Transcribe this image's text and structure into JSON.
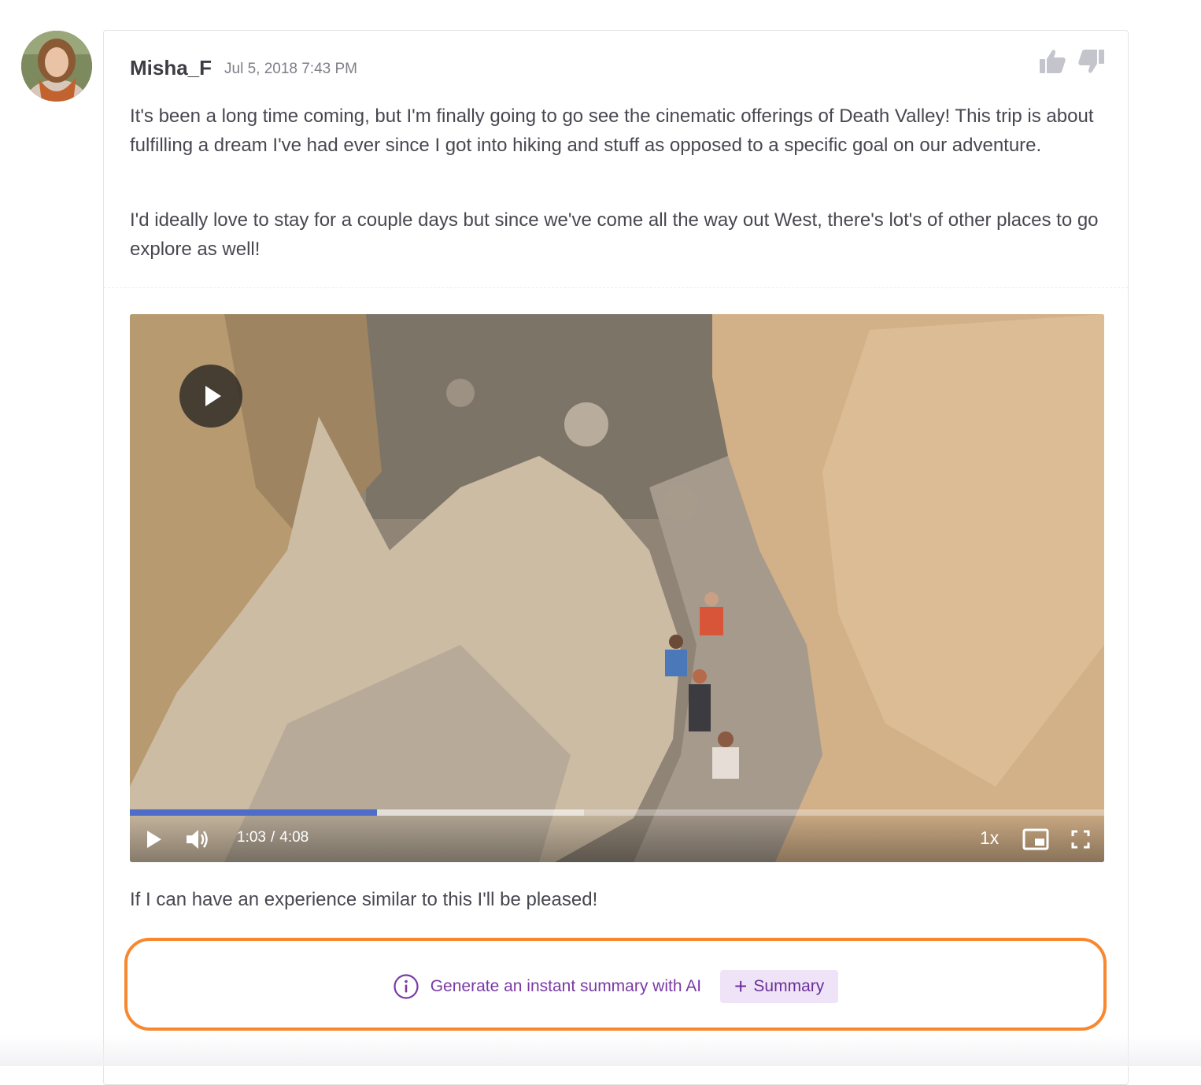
{
  "post": {
    "author": "Misha_F",
    "date": "Jul 5, 2018 7:43 PM",
    "paragraphs": [
      "It's been a long time coming, but I'm finally going to go see the cinematic offerings of Death Valley! This trip is about fulfilling a dream I've had ever since I got into hiking and stuff as opposed to a specific goal on our adventure.",
      "I'd ideally love to stay for a couple days but since we've come all the way out West, there's lot's of other places to go explore as well!"
    ],
    "after_video_text": "If I can have an experience similar to this I'll be pleased!"
  },
  "icons": {
    "avatar": "avatar-photo",
    "like": "thumbs-up-icon",
    "dislike": "thumbs-down-icon",
    "info": "info-circle-icon",
    "play": "play-icon",
    "volume": "volume-icon",
    "pip": "picture-in-picture-icon",
    "fullscreen": "fullscreen-icon"
  },
  "video": {
    "current_time": "1:03",
    "separator": "/",
    "duration": "4:08",
    "speed": "1x",
    "played_fraction": 0.254,
    "buffered_fraction": 0.466
  },
  "ai_summary": {
    "prompt_text": "Generate an instant summary with AI",
    "button_label": "Summary",
    "button_plus": "+"
  },
  "colors": {
    "highlight_border": "#f7882f",
    "ai_accent": "#7a3aa5",
    "summary_button_bg": "#efe4f7",
    "progress_played": "#4f6cc9"
  }
}
